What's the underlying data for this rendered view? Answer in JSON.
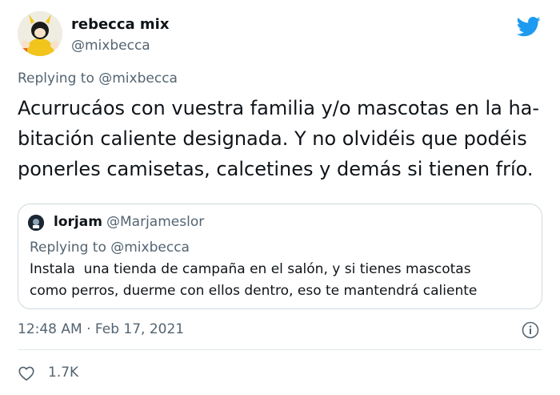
{
  "author": {
    "name": "rebecca mix",
    "handle": "@mixbecca",
    "avatar_icon": "avatar-yellow-character"
  },
  "reply": {
    "prefix": "Replying to ",
    "mention": "@mixbecca"
  },
  "tweet": {
    "lines": [
      "Acurrucáos con vuestra familia y/o mascotas en la ha-",
      "bitación caliente designada. Y no olvidéis que podéis",
      "ponerles camisetas, calcetines y demás si tienen frío."
    ]
  },
  "quoted": {
    "name": "lorjam",
    "handle": "@Marjameslor",
    "reply_prefix": "Replying to ",
    "reply_mention": "@mixbecca",
    "lines": [
      "Instala  una tienda de campaña en el salón, y si tienes mascotas",
      "como perros, duerme con ellos dentro, eso te mantendrá caliente"
    ]
  },
  "meta": {
    "time": "12:48 AM",
    "separator": " · ",
    "date": "Feb 17, 2021"
  },
  "engagement": {
    "likes": "1.7K"
  },
  "colors": {
    "brand": "#1d9bf0",
    "text": "#0f1419",
    "muted": "#536471",
    "border": "#cfd9de"
  },
  "icons": [
    "twitter-bird-icon",
    "info-icon",
    "heart-icon"
  ]
}
